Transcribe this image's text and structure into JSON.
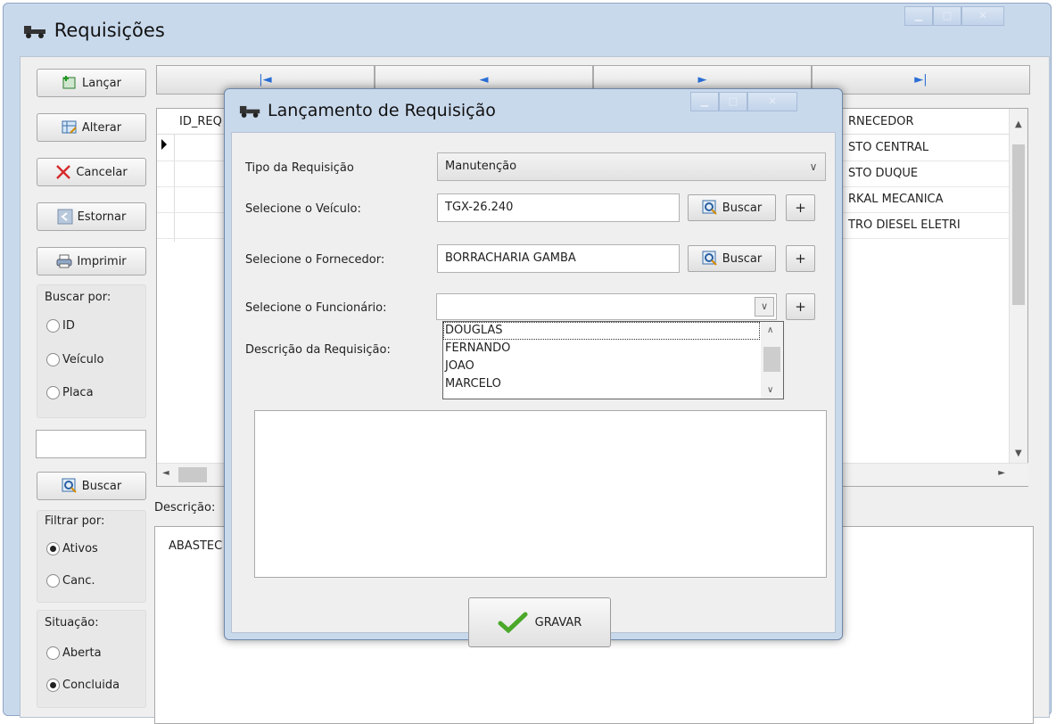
{
  "window": {
    "title": "Requisições"
  },
  "sidebar": {
    "buttons": [
      {
        "label": "Lançar",
        "icon": "add-document-icon"
      },
      {
        "label": "Alterar",
        "icon": "edit-grid-icon"
      },
      {
        "label": "Cancelar",
        "icon": "cancel-x-icon"
      },
      {
        "label": "Estornar",
        "icon": "reverse-icon"
      },
      {
        "label": "Imprimir",
        "icon": "printer-icon"
      }
    ],
    "search_group": {
      "label": "Buscar por:",
      "options": [
        "ID",
        "Veículo",
        "Placa"
      ],
      "selected": null
    },
    "search_input": {
      "value": ""
    },
    "search_button": {
      "label": "Buscar",
      "icon": "search-icon"
    },
    "filter_group": {
      "label": "Filtrar por:",
      "options": [
        "Ativos",
        "Canc."
      ],
      "selected": "Ativos"
    },
    "status_group": {
      "label": "Situação:",
      "options": [
        "Aberta",
        "Concluida"
      ],
      "selected": "Concluida"
    }
  },
  "navigation": {
    "first": "|◄",
    "prev": "◄",
    "next": "►",
    "last": "►|"
  },
  "grid": {
    "left_header": "ID_REQ",
    "right_header": "RNECEDOR",
    "right_column_values": [
      "STO CENTRAL",
      "STO DUQUE",
      "RKAL MECANICA",
      "TRO DIESEL ELETRI"
    ]
  },
  "description": {
    "label": "Descrição:",
    "value": "ABASTEC"
  },
  "dialog": {
    "title": "Lançamento de Requisição",
    "tipo": {
      "label": "Tipo da Requisição",
      "value": "Manutenção"
    },
    "veiculo": {
      "label": "Selecione o Veículo:",
      "value": "TGX-26.240",
      "search_label": "Buscar",
      "add_label": "+"
    },
    "fornecedor": {
      "label": "Selecione o Fornecedor:",
      "value": "BORRACHARIA GAMBA",
      "search_label": "Buscar",
      "add_label": "+"
    },
    "funcionario": {
      "label": "Selecione o Funcionário:",
      "value": "",
      "add_label": "+",
      "options": [
        "DOUGLAS",
        "FERNANDO",
        "JOAO",
        "MARCELO"
      ],
      "highlighted": "DOUGLAS"
    },
    "descricao": {
      "label": "Descrição da Requisição:",
      "value": ""
    },
    "save_label": "GRAVAR"
  }
}
